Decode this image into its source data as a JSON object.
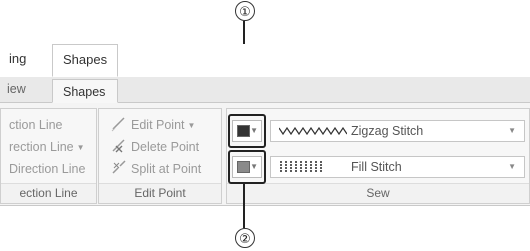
{
  "callouts": {
    "top": "①",
    "bottom": "②"
  },
  "tabs": {
    "partial_tab": "ing",
    "active_tab": "Shapes"
  },
  "subtabs": {
    "partial_subtab": "iew",
    "active_subtab": "Shapes"
  },
  "groups": {
    "direction_line": {
      "items": [
        "ction Line",
        "rection Line",
        "Direction Line"
      ],
      "label": "ection Line"
    },
    "edit_point": {
      "items": [
        "Edit Point",
        "Delete Point",
        "Split at Point"
      ],
      "label": "Edit Point"
    },
    "sew": {
      "line_stitch": "Zigzag Stitch",
      "fill_stitch": "Fill Stitch",
      "label": "Sew"
    }
  },
  "colors": {
    "line_color": "#333333",
    "fill_color": "#8a8a8a",
    "ribbon_bg": "#f4f4f4",
    "tab_strip": "#e9e9e9"
  },
  "icons": {
    "edit_point": "edit-point-icon",
    "delete_point": "delete-point-icon",
    "split_point": "split-point-icon",
    "zigzag_pattern": "zigzag-pattern-icon",
    "fill_pattern": "fill-pattern-icon"
  }
}
